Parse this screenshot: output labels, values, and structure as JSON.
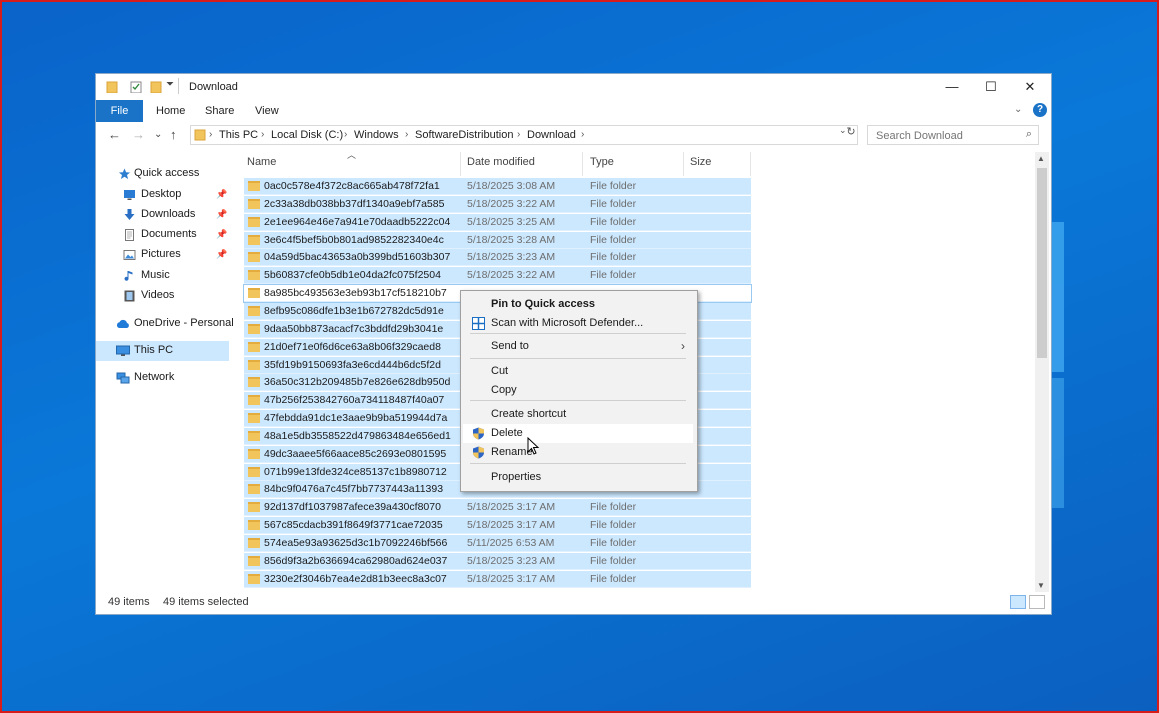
{
  "window": {
    "title": "Download",
    "min_glyph": "—",
    "max_glyph": "☐",
    "close_glyph": "✕"
  },
  "ribbon": {
    "tabs": [
      "File",
      "Home",
      "Share",
      "View"
    ],
    "collapse_glyph": "⌄",
    "help_glyph": "?"
  },
  "address_bar": {
    "back_glyph": "←",
    "forward_glyph": "→",
    "recent_glyph": "⌄",
    "up_glyph": "↑",
    "breadcrumbs": [
      "This PC",
      "Local Disk (C:)",
      "Windows",
      "SoftwareDistribution",
      "Download"
    ],
    "separator": "›",
    "search_placeholder": "Search Download"
  },
  "nav_pane": {
    "items": [
      {
        "label": "Quick access",
        "icon": "star-icon",
        "pinned": false,
        "selected": false
      },
      {
        "label": "Desktop",
        "icon": "desktop-icon",
        "pinned": true,
        "selected": false
      },
      {
        "label": "Downloads",
        "icon": "download-arrow-icon",
        "pinned": true,
        "selected": false
      },
      {
        "label": "Documents",
        "icon": "document-icon",
        "pinned": true,
        "selected": false
      },
      {
        "label": "Pictures",
        "icon": "picture-icon",
        "pinned": true,
        "selected": false
      },
      {
        "label": "Music",
        "icon": "music-note-icon",
        "pinned": false,
        "selected": false
      },
      {
        "label": "Videos",
        "icon": "video-icon",
        "pinned": false,
        "selected": false
      },
      {
        "label": "OneDrive - Personal",
        "icon": "cloud-icon",
        "pinned": false,
        "selected": false
      },
      {
        "label": "This PC",
        "icon": "monitor-icon",
        "pinned": false,
        "selected": true
      },
      {
        "label": "Network",
        "icon": "network-icon",
        "pinned": false,
        "selected": false
      }
    ]
  },
  "file_list": {
    "columns": [
      "Name",
      "Date modified",
      "Type",
      "Size"
    ],
    "rows": [
      {
        "name": "0ac0c578e4f372c8ac665ab478f72fa1",
        "date": "5/18/2025 3:08 AM",
        "type": "File folder"
      },
      {
        "name": "2c33a38db038bb37df1340a9ebf7a585",
        "date": "5/18/2025 3:22 AM",
        "type": "File folder"
      },
      {
        "name": "2e1ee964e46e7a941e70daadb5222c04",
        "date": "5/18/2025 3:25 AM",
        "type": "File folder"
      },
      {
        "name": "3e6c4f5bef5b0b801ad9852282340e4c",
        "date": "5/18/2025 3:28 AM",
        "type": "File folder"
      },
      {
        "name": "04a59d5bac43653a0b399bd51603b307",
        "date": "5/18/2025 3:23 AM",
        "type": "File folder"
      },
      {
        "name": "5b60837cfe0b5db1e04da2fc075f2504",
        "date": "5/18/2025 3:22 AM",
        "type": "File folder"
      },
      {
        "name": "8a985bc493563e3eb93b17cf518210b7",
        "date": "",
        "type": ""
      },
      {
        "name": "8efb95c086dfe1b3e1b672782dc5d91e",
        "date": "",
        "type": ""
      },
      {
        "name": "9daa50bb873acacf7c3bddfd29b3041e",
        "date": "",
        "type": ""
      },
      {
        "name": "21d0ef71e0f6d6ce63a8b06f329caed8",
        "date": "",
        "type": ""
      },
      {
        "name": "35fd19b9150693fa3e6cd444b6dc5f2d",
        "date": "",
        "type": ""
      },
      {
        "name": "36a50c312b209485b7e826e628db950d",
        "date": "",
        "type": ""
      },
      {
        "name": "47b256f253842760a734118487f40a07",
        "date": "",
        "type": ""
      },
      {
        "name": "47febdda91dc1e3aae9b9ba519944d7a",
        "date": "",
        "type": ""
      },
      {
        "name": "48a1e5db3558522d479863484e656ed1",
        "date": "",
        "type": ""
      },
      {
        "name": "49dc3aaee5f66aace85c2693e0801595",
        "date": "",
        "type": ""
      },
      {
        "name": "071b99e13fde324ce85137c1b8980712",
        "date": "",
        "type": ""
      },
      {
        "name": "84bc9f0476a7c45f7bb7737443a11393",
        "date": "",
        "type": ""
      },
      {
        "name": "92d137df1037987afece39a430cf8070",
        "date": "5/18/2025 3:17 AM",
        "type": "File folder"
      },
      {
        "name": "567c85cdacb391f8649f3771cae72035",
        "date": "5/18/2025 3:17 AM",
        "type": "File folder"
      },
      {
        "name": "574ea5e93a93625d3c1b7092246bf566",
        "date": "5/11/2025 6:53 AM",
        "type": "File folder"
      },
      {
        "name": "856d9f3a2b636694ca62980ad624e037",
        "date": "5/18/2025 3:23 AM",
        "type": "File folder"
      },
      {
        "name": "3230e2f3046b7ea4e2d81b3eec8a3c07",
        "date": "5/18/2025 3:17 AM",
        "type": "File folder"
      }
    ]
  },
  "context_menu": {
    "items": [
      {
        "label": "Pin to Quick access",
        "bold": true,
        "icon": "",
        "submenu": false
      },
      {
        "label": "Scan with Microsoft Defender...",
        "bold": false,
        "icon": "defender-icon",
        "submenu": false
      },
      {
        "label": "Send to",
        "bold": false,
        "icon": "",
        "submenu": true
      },
      {
        "label": "Cut",
        "bold": false,
        "icon": "",
        "submenu": false
      },
      {
        "label": "Copy",
        "bold": false,
        "icon": "",
        "submenu": false
      },
      {
        "label": "Create shortcut",
        "bold": false,
        "icon": "",
        "submenu": false
      },
      {
        "label": "Delete",
        "bold": false,
        "icon": "uac-shield-icon",
        "submenu": false
      },
      {
        "label": "Rename",
        "bold": false,
        "icon": "uac-shield-icon",
        "submenu": false
      },
      {
        "label": "Properties",
        "bold": false,
        "icon": "",
        "submenu": false
      }
    ],
    "hovered": "Delete",
    "submenu_glyph": "›"
  },
  "status_bar": {
    "item_count": "49 items",
    "selected_count": "49 items selected"
  },
  "colors": {
    "accent": "#1a73c7",
    "selection": "#cce8ff",
    "desktop": "#0a72d2",
    "frame": "#d81b1b"
  }
}
